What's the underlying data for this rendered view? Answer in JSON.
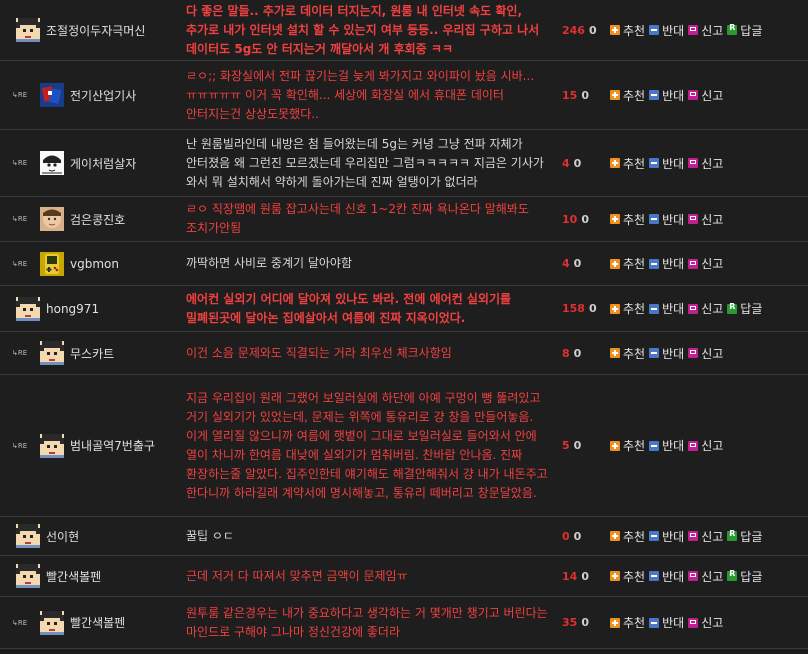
{
  "labels": {
    "re": "↳RE",
    "upvote": "추천",
    "downvote": "반대",
    "report": "신고",
    "reply": "답글"
  },
  "comments": [
    {
      "nick": "조절정이두자극머신",
      "avatar": "default",
      "is_reply": false,
      "style": "red-bold",
      "text": "다 좋은 말들.. 추가로 데이터 터지는지, 원룸 내 인터넷 속도 확인, 추가로 내가 인터넷 설치 할 수 있는지 여부 등등.. 우리집 구하고 나서 데이터도 5g도 안 터지는거 깨달아서 개 후회중 ㅋㅋ",
      "up": "246",
      "down": "0",
      "has_reply": true
    },
    {
      "nick": "전기산업기사",
      "avatar": "cards",
      "is_reply": true,
      "style": "red",
      "text": "ㄹㅇ;; 화장실에서 전파 끊기는걸 늦게 봐가지고 와이파이 놨음 시바... ㅠㅠㅠㅠㅠ 이거 꼭 확인해... 세상에 화장실 에서 휴대폰 데이터 안터지는건 상상도못했다..",
      "up": "15",
      "down": "0",
      "has_reply": false
    },
    {
      "nick": "게이처럼살자",
      "avatar": "bw",
      "is_reply": true,
      "style": "plain",
      "text": "난 원룸빌라인데 내방은 첨 들어왔는데 5g는 커녕 그냥 전파 자체가 안터졌음 왜 그런진 모르겠는데 우리집만 그럼ㅋㅋㅋㅋㅋ 지금은 기사가 와서 뭐 설치해서 약하게 돌아가는데 진짜 얼탱이가 없더라",
      "up": "4",
      "down": "0",
      "has_reply": false
    },
    {
      "nick": "검은콩진호",
      "avatar": "face",
      "is_reply": true,
      "style": "red",
      "text": "ㄹㅇ 직장땜에 원룸 잡고사는데 신호 1~2칸 진짜 욕나온다 말해봐도 조치가안됨",
      "up": "10",
      "down": "0",
      "has_reply": false
    },
    {
      "nick": "vgbmon",
      "avatar": "gameboy",
      "is_reply": true,
      "style": "plain",
      "text": "까딱하면 사비로 중계기 달아야함",
      "up": "4",
      "down": "0",
      "has_reply": false
    },
    {
      "nick": "hong971",
      "avatar": "default",
      "is_reply": false,
      "style": "red-bold",
      "text": "에어컨 실외기 어디에 달아져 있나도 봐라. 전에 에어컨 실외기를 밀폐된곳에 달아논 집에살아서 여름에 진짜 지옥이었다.",
      "up": "158",
      "down": "0",
      "has_reply": true
    },
    {
      "nick": "무스카트",
      "avatar": "default",
      "is_reply": true,
      "style": "red",
      "text": "이건 소음 문제와도 직결되는 거라 최우선 체크사항임",
      "up": "8",
      "down": "0",
      "has_reply": false
    },
    {
      "nick": "범내골역7번출구",
      "avatar": "default",
      "is_reply": true,
      "style": "red",
      "text": "지금 우리집이 원래 그랬어 보일러실에 하단에 아예 구멍이 뻥 뚫려있고 거기 실외기가 있었는데, 문제는 위쪽에 통유리로 걍 창을 만들어놓음. 이게 열리질 않으니까 여름에 햇볕이 그대로 보일러실로 들어와서 안에 열이 차니까 한여름 대낮에 실외기가 멈춰버림. 찬바람 안나옴. 진짜 환장하는줄 알았다. 집주인한테 얘기해도 해결안해줘서 걍 내가 내돈주고 한다니까 하라길래 계약서에 명시해놓고, 통유리 떼버리고 창문달았음.",
      "up": "5",
      "down": "0",
      "has_reply": false
    },
    {
      "nick": "선이현",
      "avatar": "default",
      "is_reply": false,
      "style": "plain",
      "text": "꿀팁 ㅇㄷ",
      "up": "0",
      "down": "0",
      "has_reply": true
    },
    {
      "nick": "빨간색볼펜",
      "avatar": "default",
      "is_reply": false,
      "style": "red",
      "text": "근데 저거 다 따져서 맞추면 금액이 문제임ㅠ",
      "up": "14",
      "down": "0",
      "has_reply": true
    },
    {
      "nick": "빨간색볼펜",
      "avatar": "default",
      "is_reply": true,
      "style": "red",
      "text": "원투룸 같은경우는 내가 중요하다고 생각하는 거 몇개만 챙기고 버린다는 마인드로 구해야 그나마 정신건강에 좋더라",
      "up": "35",
      "down": "0",
      "has_reply": false
    }
  ]
}
